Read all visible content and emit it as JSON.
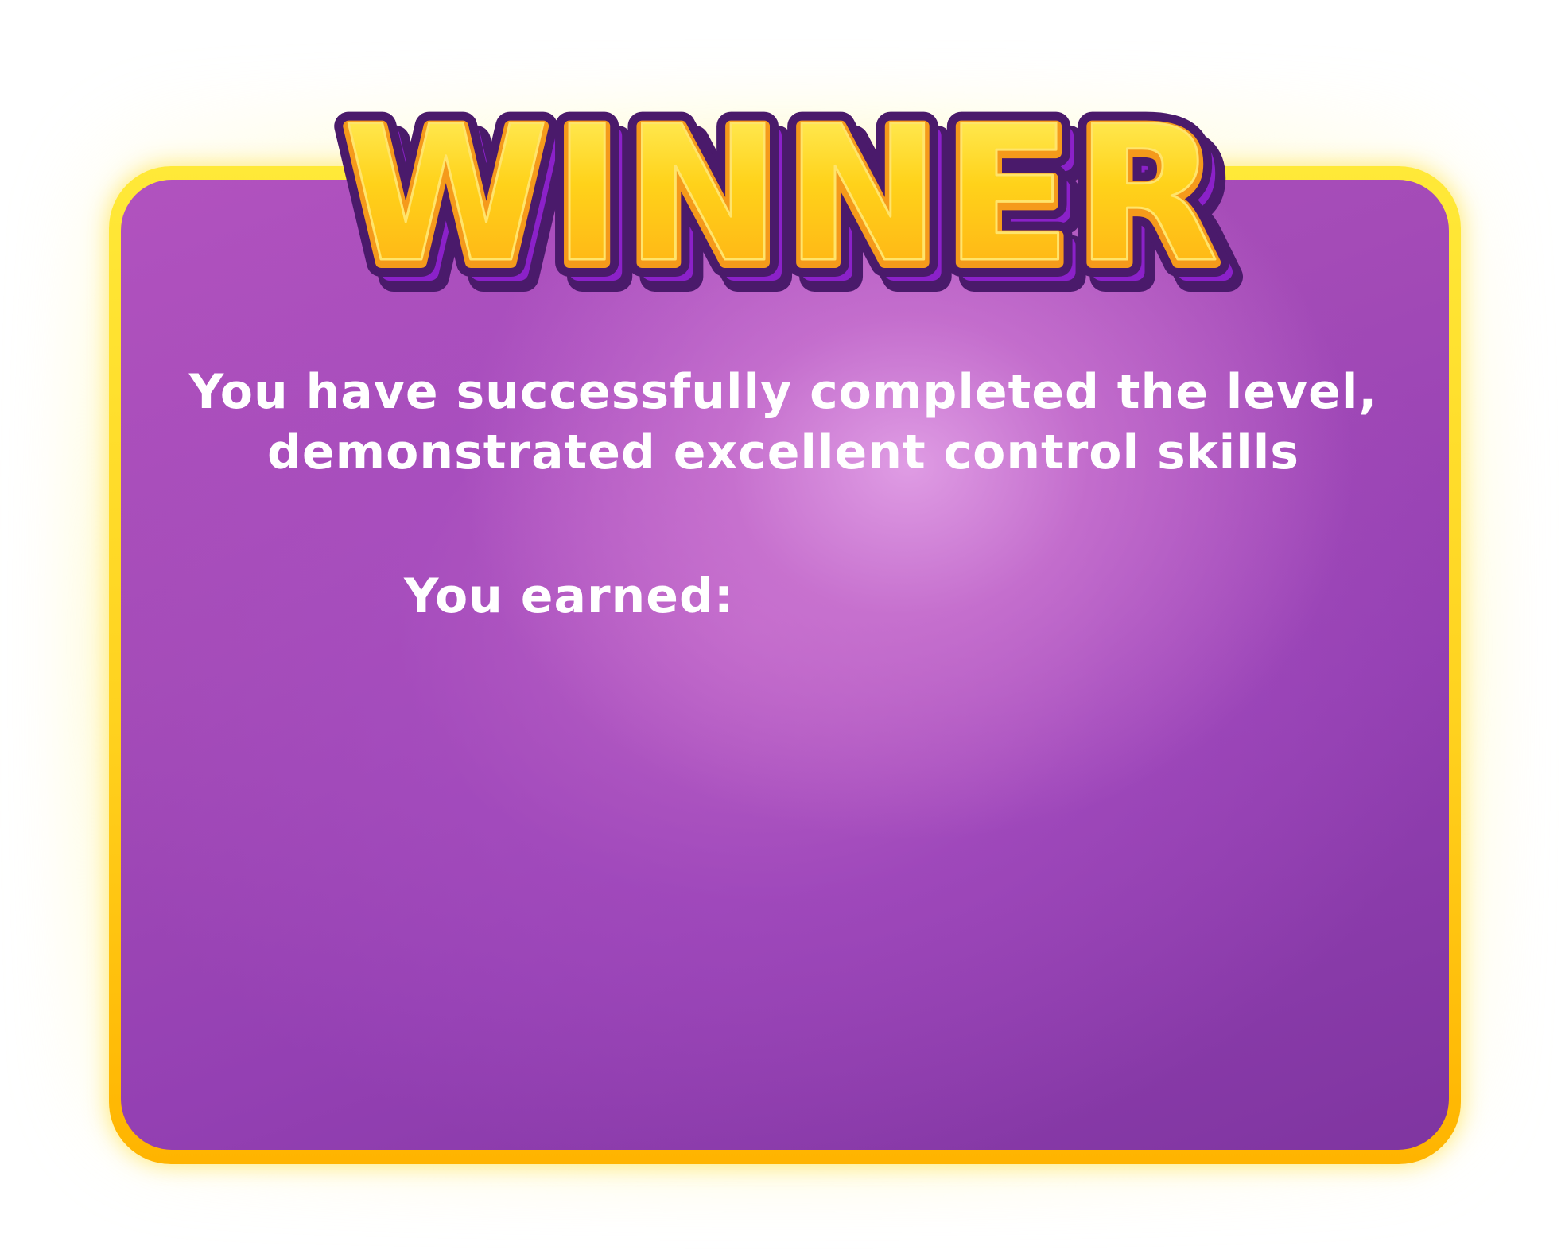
{
  "dialog": {
    "title": "WINNER",
    "message_line1": "You have successfully completed the level,",
    "message_line2": "demonstrated excellent control skills",
    "earned_label": "You earned:"
  },
  "colors": {
    "panel_purple": "#a44bb7",
    "panel_border_gold": "#ffd21f",
    "title_fill_yellow": "#ffd21a",
    "title_outline_orange": "#f59a1b",
    "title_outer_stroke": "#4a1a6b",
    "title_shadow_purple": "#8b21c9",
    "text_white": "#ffffff"
  }
}
